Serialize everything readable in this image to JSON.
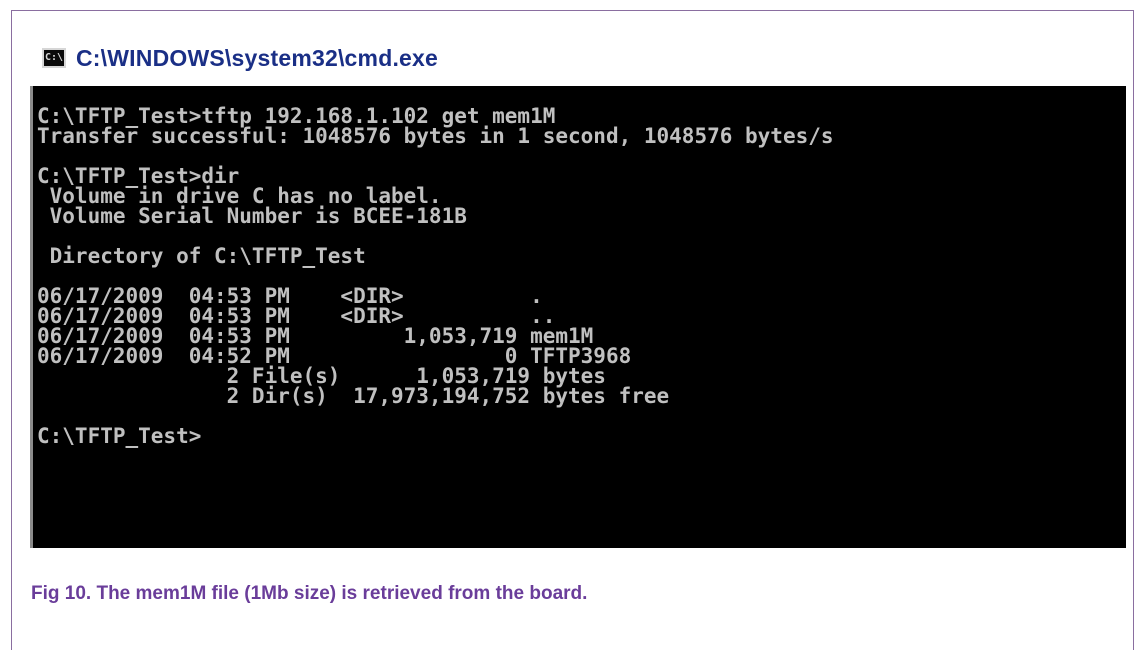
{
  "window": {
    "title": "C:\\WINDOWS\\system32\\cmd.exe",
    "icon_text": "C:\\",
    "icon_name": "cmd-icon"
  },
  "console": {
    "lines": [
      "C:\\TFTP_Test>tftp 192.168.1.102 get mem1M",
      "Transfer successful: 1048576 bytes in 1 second, 1048576 bytes/s",
      "",
      "C:\\TFTP_Test>dir",
      " Volume in drive C has no label.",
      " Volume Serial Number is BCEE-181B",
      "",
      " Directory of C:\\TFTP_Test",
      "",
      "06/17/2009  04:53 PM    <DIR>          .",
      "06/17/2009  04:53 PM    <DIR>          ..",
      "06/17/2009  04:53 PM         1,053,719 mem1M",
      "06/17/2009  04:52 PM                 0 TFTP3968",
      "               2 File(s)      1,053,719 bytes",
      "               2 Dir(s)  17,973,194,752 bytes free",
      "",
      "C:\\TFTP_Test>"
    ],
    "text_color": "#c0c0c0",
    "background_color": "#000000"
  },
  "caption": {
    "text": "Fig 10.  The mem1M file (1Mb size) is retrieved from the board.",
    "color": "#6a3d9a"
  }
}
